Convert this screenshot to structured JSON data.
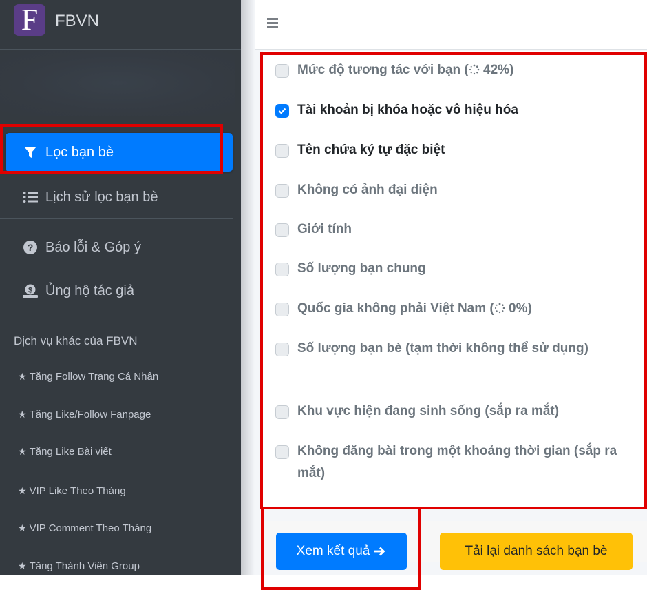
{
  "brand": {
    "logo_letter": "F",
    "name": "FBVN"
  },
  "sidebar": {
    "nav": [
      {
        "label": "Lọc bạn bè",
        "icon": "filter-icon",
        "active": true
      },
      {
        "label": "Lịch sử lọc bạn bè",
        "icon": "list-icon",
        "active": false
      },
      {
        "label": "Báo lỗi & Góp ý",
        "icon": "question-circle-icon",
        "active": false
      },
      {
        "label": "Ủng hộ tác giả",
        "icon": "donate-icon",
        "active": false
      }
    ],
    "section_title": "Dịch vụ khác của FBVN",
    "services": [
      {
        "label": "Tăng Follow Trang Cá Nhân"
      },
      {
        "label": "Tăng Like/Follow Fanpage"
      },
      {
        "label": "Tăng Like Bài viết"
      },
      {
        "label": "VIP Like Theo Tháng"
      },
      {
        "label": "VIP Comment Theo Tháng"
      },
      {
        "label": "Tăng Thành Viên Group"
      }
    ],
    "star_glyph": "★"
  },
  "topbar": {
    "menu_icon": "hamburger-icon"
  },
  "filters": [
    {
      "label_pre": "Mức độ tương tác với bạn (",
      "progress": "42%",
      "label_post": ")",
      "checked": false,
      "loading": true,
      "dark": false
    },
    {
      "label": "Tài khoản bị khóa hoặc vô hiệu hóa",
      "checked": true,
      "dark": true
    },
    {
      "label": "Tên chứa ký tự đặc biệt",
      "checked": false,
      "dark": true
    },
    {
      "label": "Không có ảnh đại diện",
      "checked": false,
      "dark": false
    },
    {
      "label": "Giới tính",
      "checked": false,
      "dark": false
    },
    {
      "label": "Số lượng bạn chung",
      "checked": false,
      "dark": false
    },
    {
      "label_pre": "Quốc gia không phải Việt Nam (",
      "progress": "0%",
      "label_post": ")",
      "checked": false,
      "loading": true,
      "dark": false
    },
    {
      "label": "Số lượng bạn bè (tạm thời không thể sử dụng)",
      "checked": false,
      "dark": false
    },
    {
      "label": "Khu vực hiện đang sinh sống (sắp ra mắt)",
      "checked": false,
      "dark": false
    },
    {
      "label": "Không đăng bài trong một khoảng thời gian (sắp ra mắt)",
      "checked": false,
      "dark": false
    }
  ],
  "actions": {
    "view_results": "Xem kết quả",
    "reload_friends": "Tải lại danh sách bạn bè"
  },
  "colors": {
    "primary": "#007bff",
    "warning": "#ffc107",
    "sidebar": "#343a40",
    "highlight": "#e00000",
    "brand": "#5a3d87"
  }
}
